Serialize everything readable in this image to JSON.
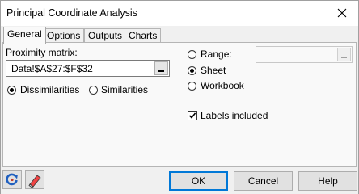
{
  "window": {
    "title": "Principal Coordinate Analysis"
  },
  "tabs": [
    {
      "label": "General",
      "active": true
    },
    {
      "label": "Options",
      "active": false
    },
    {
      "label": "Outputs",
      "active": false
    },
    {
      "label": "Charts",
      "active": false
    }
  ],
  "general": {
    "proximity_label": "Proximity matrix:",
    "proximity_value": "Data!$A$27:$F$32",
    "range_label": "Range:",
    "range_value": "",
    "sheet_label": "Sheet",
    "workbook_label": "Workbook",
    "labels_included_label": "Labels included",
    "labels_included_checked": true,
    "output_selected": "Sheet",
    "dissimilarities_label": "Dissimilarities",
    "similarities_label": "Similarities",
    "matrix_type_selected": "Dissimilarities"
  },
  "footer": {
    "ok_label": "OK",
    "cancel_label": "Cancel",
    "help_label": "Help",
    "reset_icon": "reset-icon",
    "eraser_icon": "eraser-icon"
  },
  "colors": {
    "accent": "#0078d7",
    "panel": "#f9f9f9",
    "titlebar": "#ffffff"
  }
}
